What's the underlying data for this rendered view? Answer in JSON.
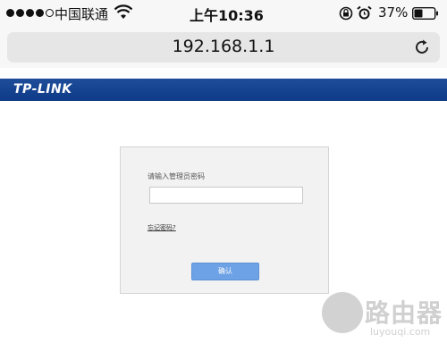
{
  "status_bar": {
    "carrier": "中国联通",
    "time": "上午10:36",
    "battery_percent": "37%",
    "signal_bars_filled": 4,
    "signal_bars_total": 5
  },
  "address_bar": {
    "url": "192.168.1.1"
  },
  "header": {
    "logo_text": "TP-LINK",
    "background_color": "#1f4d9a"
  },
  "login": {
    "password_label": "请输入管理员密码",
    "password_value": "",
    "forgot_password": "忘记密码?",
    "confirm_button": "确认",
    "button_color": "#6ea2e6"
  },
  "watermark": {
    "title": "路由器",
    "url": "luyouqi.com"
  }
}
